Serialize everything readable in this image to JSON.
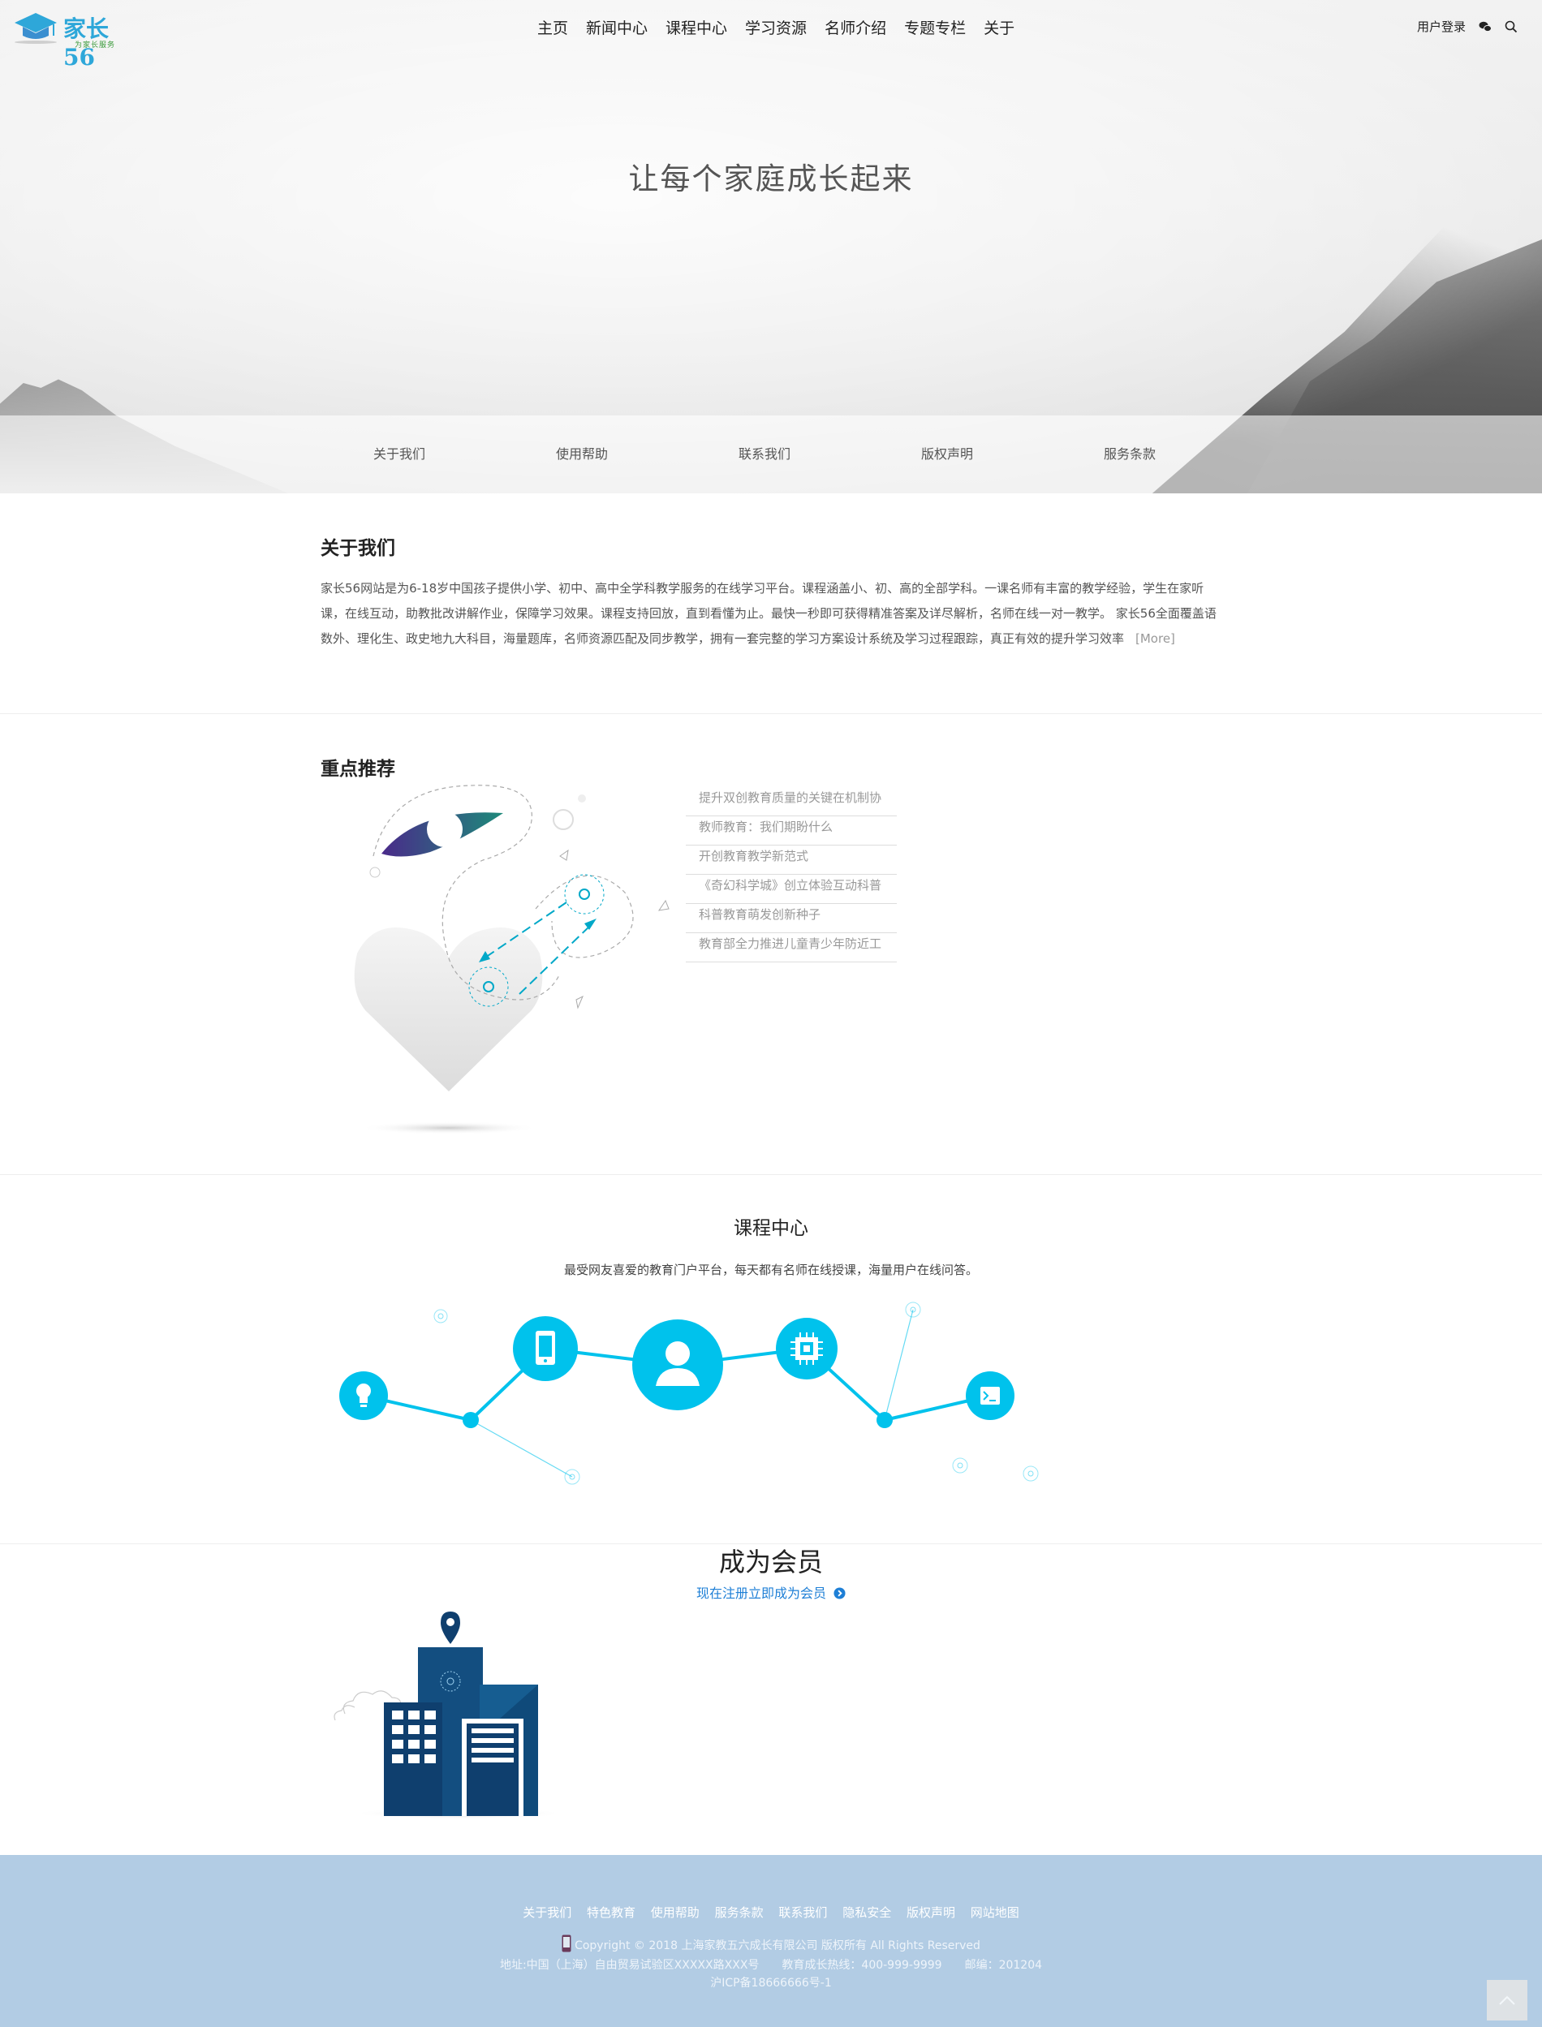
{
  "header": {
    "logo_text": "家长56",
    "logo_slogan": "为家长服务",
    "nav": [
      "主页",
      "新闻中心",
      "课程中心",
      "学习资源",
      "名师介绍",
      "专题专栏",
      "关于"
    ],
    "login": "用户登录"
  },
  "hero": {
    "title": "让每个家庭成长起来"
  },
  "subnav": [
    "关于我们",
    "使用帮助",
    "联系我们",
    "版权声明",
    "服务条款"
  ],
  "about": {
    "title": "关于我们",
    "text": "家长56网站是为6-18岁中国孩子提供小学、初中、高中全学科教学服务的在线学习平台。课程涵盖小、初、高的全部学科。一课名师有丰富的教学经验，学生在家听课，在线互动，助教批改讲解作业，保障学习效果。课程支持回放，直到看懂为止。最快一秒即可获得精准答案及详尽解析，名师在线一对一教学。 家长56全面覆盖语数外、理化生、政史地九大科目，海量题库，名师资源匹配及同步教学，拥有一套完整的学习方案设计系统及学习过程跟踪，真正有效的提升学习效率",
    "more": "[More]"
  },
  "recommend": {
    "title": "重点推荐",
    "items": [
      "提升双创教育质量的关键在机制协",
      "教师教育：我们期盼什么",
      "开创教育教学新范式",
      "《奇幻科学城》创立体验互动科普",
      "科普教育萌发创新种子",
      "教育部全力推进儿童青少年防近工"
    ]
  },
  "courses": {
    "title": "课程中心",
    "subtitle": "最受网友喜爱的教育门户平台，每天都有名师在线授课，海量用户在线问答。"
  },
  "member": {
    "title": "成为会员",
    "link": "现在注册立即成为会员"
  },
  "footer": {
    "links": [
      "关于我们",
      "特色教育",
      "使用帮助",
      "服务条款",
      "联系我们",
      "隐私安全",
      "版权声明",
      "网站地图"
    ],
    "copyright": "Copyright © 2018 上海家教五六成长有限公司 版权所有 All Rights Reserved",
    "address": "地址:中国（上海）自由贸易试验区XXXXX路XXX号　　教育成长热线：400-999-9999　　邮编：201204",
    "icp": "沪ICP备18666666号-1"
  },
  "colors": {
    "accent": "#00c2ec",
    "footer_bg": "#b2cce4",
    "link_blue": "#1e7fd6",
    "building_dark": "#0f3f6e"
  },
  "icons": [
    "logo-cap-icon",
    "wechat-icon",
    "search-icon",
    "arrow-circle-right-icon",
    "mobile-phone-icon",
    "lightbulb-icon",
    "user-icon",
    "chip-icon",
    "terminal-icon",
    "back-to-top-icon"
  ]
}
